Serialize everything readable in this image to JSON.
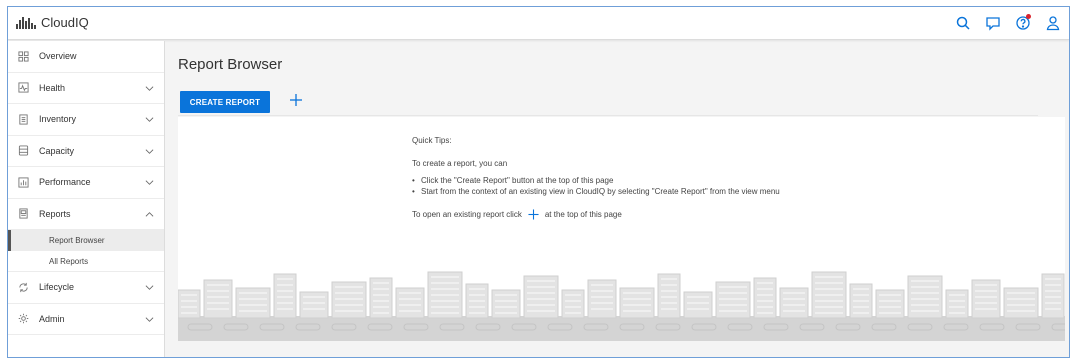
{
  "app": {
    "name": "CloudIQ",
    "logo_icon": "cloudiq-bars-icon"
  },
  "header_icons": [
    {
      "name": "search-icon"
    },
    {
      "name": "chat-icon"
    },
    {
      "name": "help-icon",
      "notification": true,
      "dot_color": "#d9232d"
    },
    {
      "name": "user-icon"
    }
  ],
  "sidebar": {
    "items": [
      {
        "label": "Overview",
        "icon": "grid-icon",
        "chevron": "none"
      },
      {
        "label": "Health",
        "icon": "health-icon",
        "chevron": "down"
      },
      {
        "label": "Inventory",
        "icon": "inventory-icon",
        "chevron": "down"
      },
      {
        "label": "Capacity",
        "icon": "capacity-icon",
        "chevron": "down"
      },
      {
        "label": "Performance",
        "icon": "performance-icon",
        "chevron": "down"
      },
      {
        "label": "Reports",
        "icon": "reports-icon",
        "chevron": "up",
        "children": [
          {
            "label": "Report Browser",
            "active": true
          },
          {
            "label": "All Reports",
            "active": false
          }
        ]
      },
      {
        "label": "Lifecycle",
        "icon": "lifecycle-icon",
        "chevron": "down"
      },
      {
        "label": "Admin",
        "icon": "gear-icon",
        "chevron": "down"
      }
    ]
  },
  "main": {
    "title": "Report Browser",
    "create_button": "CREATE REPORT",
    "accent_color": "#0a74da",
    "tips": {
      "heading": "Quick Tips:",
      "intro": "To create a report, you can",
      "bullets": [
        "Click the \"Create Report\" button at the top of this page",
        "Start from the context of an existing view in CloudIQ by selecting \"Create Report\" from the view menu"
      ],
      "open_before": "To open an existing report click",
      "open_after": "at the top of this page"
    }
  }
}
